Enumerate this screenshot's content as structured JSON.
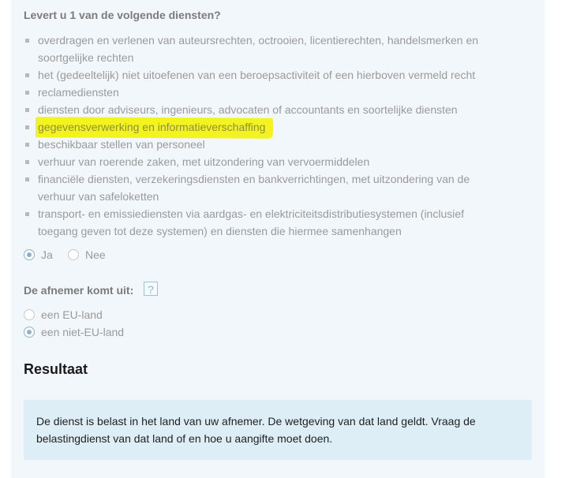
{
  "question1": {
    "label": "Levert u 1 van de volgende diensten?",
    "services": [
      {
        "line1": "overdragen en verlenen van auteursrechten, octrooien, licentierechten, handelsmerken en",
        "line2": "soortgelijke rechten"
      },
      {
        "line1": "het (gedeeltelijk) niet uitoefenen van een beroepsactiviteit of een hierboven vermeld recht"
      },
      {
        "line1": "reclamediensten"
      },
      {
        "line1": "diensten door adviseurs, ingenieurs, advocaten of accountants en soortelijke diensten"
      },
      {
        "line1": "gegevensverwerking en informatieverschaffing",
        "highlighted": true
      },
      {
        "line1": "beschikbaar stellen van personeel"
      },
      {
        "line1": "verhuur van roerende zaken, met uitzondering van vervoermiddelen"
      },
      {
        "line1": "financiële diensten, verzekeringsdiensten en bankverrichtingen, met uitzondering van de",
        "line2": "verhuur van safeloketten"
      },
      {
        "line1": "transport- en emissiediensten via aardgas- en elektriciteitsdistributiesystemen (inclusief",
        "line2": "toegang geven tot deze systemen) en diensten die hiermee samenhangen"
      }
    ],
    "options": [
      {
        "label": "Ja",
        "selected": true
      },
      {
        "label": "Nee",
        "selected": false
      }
    ]
  },
  "question2": {
    "label": "De afnemer komt uit:",
    "help": "?",
    "options": [
      {
        "label": "een EU-land",
        "selected": false
      },
      {
        "label": "een niet-EU-land",
        "selected": true
      }
    ]
  },
  "result": {
    "title": "Resultaat",
    "text": "De dienst is belast in het land van uw afnemer. De wetgeving van dat land geldt. Vraag de belastingdienst van dat land of en hoe u aangifte moet doen."
  },
  "colors": {
    "panel_bg": "#f2f7fb",
    "highlight": "#f3f31d",
    "result_bg": "#ddeef7",
    "radio_accent": "#8bb3c9"
  }
}
